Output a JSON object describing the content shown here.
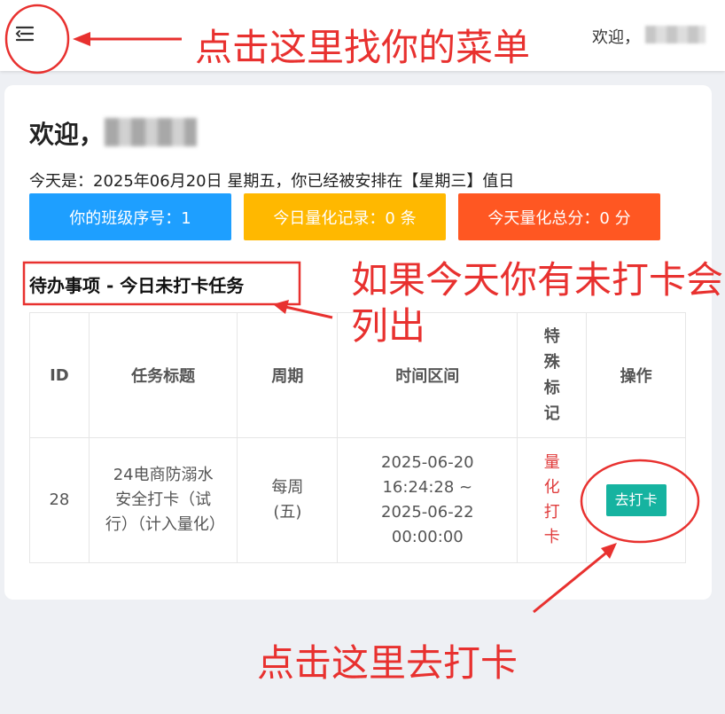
{
  "header": {
    "welcome_label": "欢迎，",
    "menu_icon": "menu-fold-icon"
  },
  "card": {
    "greeting": "欢迎，",
    "today_text": "今天是：2025年06月20日 星期五，你已经被安排在【星期三】值日",
    "buttons": [
      {
        "label": "你的班级序号：1",
        "color": "#1e9fff"
      },
      {
        "label": "今日量化记录：0 条",
        "color": "#ffb800"
      },
      {
        "label": "今天量化总分：0 分",
        "color": "#ff5722"
      }
    ],
    "section_title": "待办事项 - 今日未打卡任务"
  },
  "table": {
    "headers": [
      "ID",
      "任务标题",
      "周期",
      "时间区间",
      "特殊标记",
      "操作"
    ],
    "rows": [
      {
        "id": "28",
        "title": "24电商防溺水安全打卡（试行）（计入量化）",
        "period": "每周(五)",
        "time_start": "2025-06-20 16:24:28 ~",
        "time_end": "2025-06-22 00:00:00",
        "special": "量化打卡",
        "action": "去打卡"
      }
    ]
  },
  "annotations": {
    "menu_hint": "点击这里找你的菜单",
    "todo_hint": "如果今天你有未打卡会列出",
    "punch_hint": "点击这里去打卡",
    "color": "#e8312f"
  }
}
